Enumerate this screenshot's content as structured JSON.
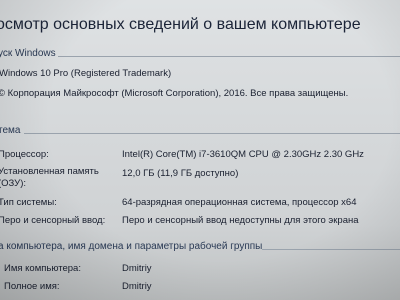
{
  "page_title": "осмотр основных сведений о вашем компьютере",
  "windows_edition": {
    "header": "уск Windows",
    "edition": "Windows 10 Pro (Registered Trademark)",
    "copyright": "© Корпорация Майкрософт (Microsoft Corporation), 2016. Все права защищены."
  },
  "system": {
    "header": "тема",
    "rows": [
      {
        "label": "Процессор:",
        "value": "Intel(R) Core(TM) i7-3610QM CPU @ 2.30GHz   2.30 GHz"
      },
      {
        "label": "Установленная память",
        "label2": "(ОЗУ):",
        "value": "12,0 ГБ (11,9 ГБ доступно)"
      },
      {
        "label": "Тип системы:",
        "value": "64-разрядная операционная система, процессор x64"
      },
      {
        "label": "Перо и сенсорный ввод:",
        "value": "Перо и сенсорный ввод недоступны для этого экрана"
      }
    ]
  },
  "computer_name": {
    "header": "а компьютера, имя домена и параметры рабочей группы",
    "rows": [
      {
        "label": "Имя компьютера:",
        "value": "Dmitriy"
      },
      {
        "label": "Полное имя:",
        "value": "Dmitriy"
      }
    ]
  }
}
